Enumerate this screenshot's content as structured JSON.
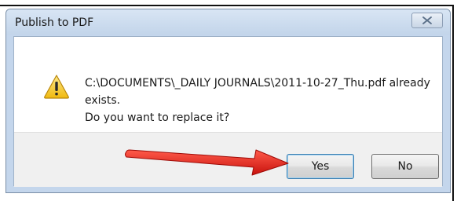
{
  "dialog": {
    "title": "Publish to PDF",
    "message_line1": "C:\\DOCUMENTS\\_DAILY JOURNALS\\2011-10-27_Thu.pdf already",
    "message_line2": "exists.",
    "message_line3": "Do you want to replace it?",
    "yes_label": "Yes",
    "no_label": "No"
  },
  "icons": {
    "close": "close-icon",
    "warning": "warning-icon",
    "arrow": "red-arrow-icon"
  },
  "colors": {
    "arrow": "#e8261e",
    "warning_fill": "#f5c518",
    "default_button_border": "#3c7fb1"
  }
}
